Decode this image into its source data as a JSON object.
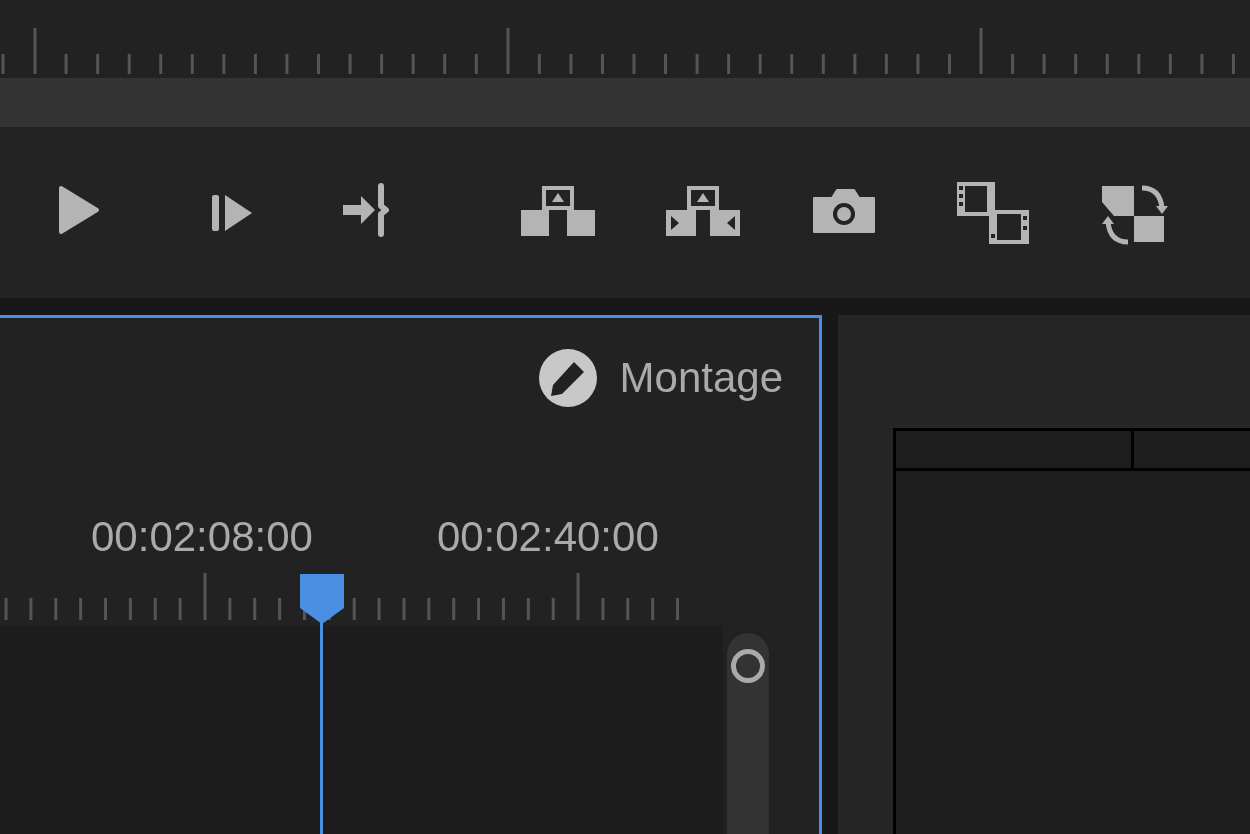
{
  "sequence_panel": {
    "active": true,
    "title": "Montage",
    "timecodes": [
      "00:02:08:00",
      "00:02:40:00"
    ]
  }
}
